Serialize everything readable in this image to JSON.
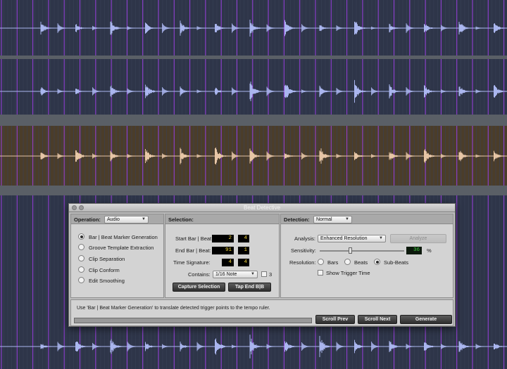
{
  "dialog": {
    "title": "Beat Detective",
    "operation": {
      "label": "Operation:",
      "value": "Audio",
      "options": [
        {
          "label": "Bar | Beat Marker Generation",
          "selected": true
        },
        {
          "label": "Groove Template Extraction",
          "selected": false
        },
        {
          "label": "Clip Separation",
          "selected": false
        },
        {
          "label": "Clip Conform",
          "selected": false
        },
        {
          "label": "Edit Smoothing",
          "selected": false
        }
      ]
    },
    "selection": {
      "header": "Selection:",
      "start_label": "Start Bar | Beat:",
      "start_bar": "2",
      "start_beat": "4",
      "end_label": "End Bar | Beat:",
      "end_bar": "91",
      "end_beat": "1",
      "sig_label": "Time Signature:",
      "sig_num": "4",
      "sig_den": "4",
      "contains_label": "Contains:",
      "contains_value": "1/16 Note",
      "tuplet_value": "3",
      "capture_button": "Capture Selection",
      "tap_button": "Tap End B|B"
    },
    "detection": {
      "header": "Detection:",
      "mode": "Normal",
      "analysis_label": "Analysis:",
      "analysis_value": "Enhanced Resolution",
      "analyze_button": "Analyze",
      "sensitivity_label": "Sensitivity:",
      "sensitivity_value": "36",
      "sensitivity_unit": "%",
      "sensitivity_fraction": 0.36,
      "resolution_label": "Resolution:",
      "resolution_options": [
        {
          "label": "Bars",
          "selected": false
        },
        {
          "label": "Beats",
          "selected": false
        },
        {
          "label": "Sub-Beats",
          "selected": true
        }
      ],
      "show_trigger_label": "Show Trigger Time",
      "show_trigger_checked": false
    },
    "footer": {
      "message": "Use 'Bar | Beat Marker Generation' to translate detected trigger points to the tempo ruler.",
      "scroll_prev": "Scroll Prev",
      "scroll_next": "Scroll Next",
      "generate": "Generate"
    }
  },
  "colors": {
    "track_bg": "#2e3549",
    "clip_bg": "#4b3d2a",
    "waveform_blue": "#aab6ef",
    "waveform_warm": "#e7c6a6",
    "marker_purple": "#9a3fe0",
    "dialog_bg": "#bdbdbd",
    "counter_yellow": "#f0d33a",
    "counter_green": "#43d043"
  }
}
